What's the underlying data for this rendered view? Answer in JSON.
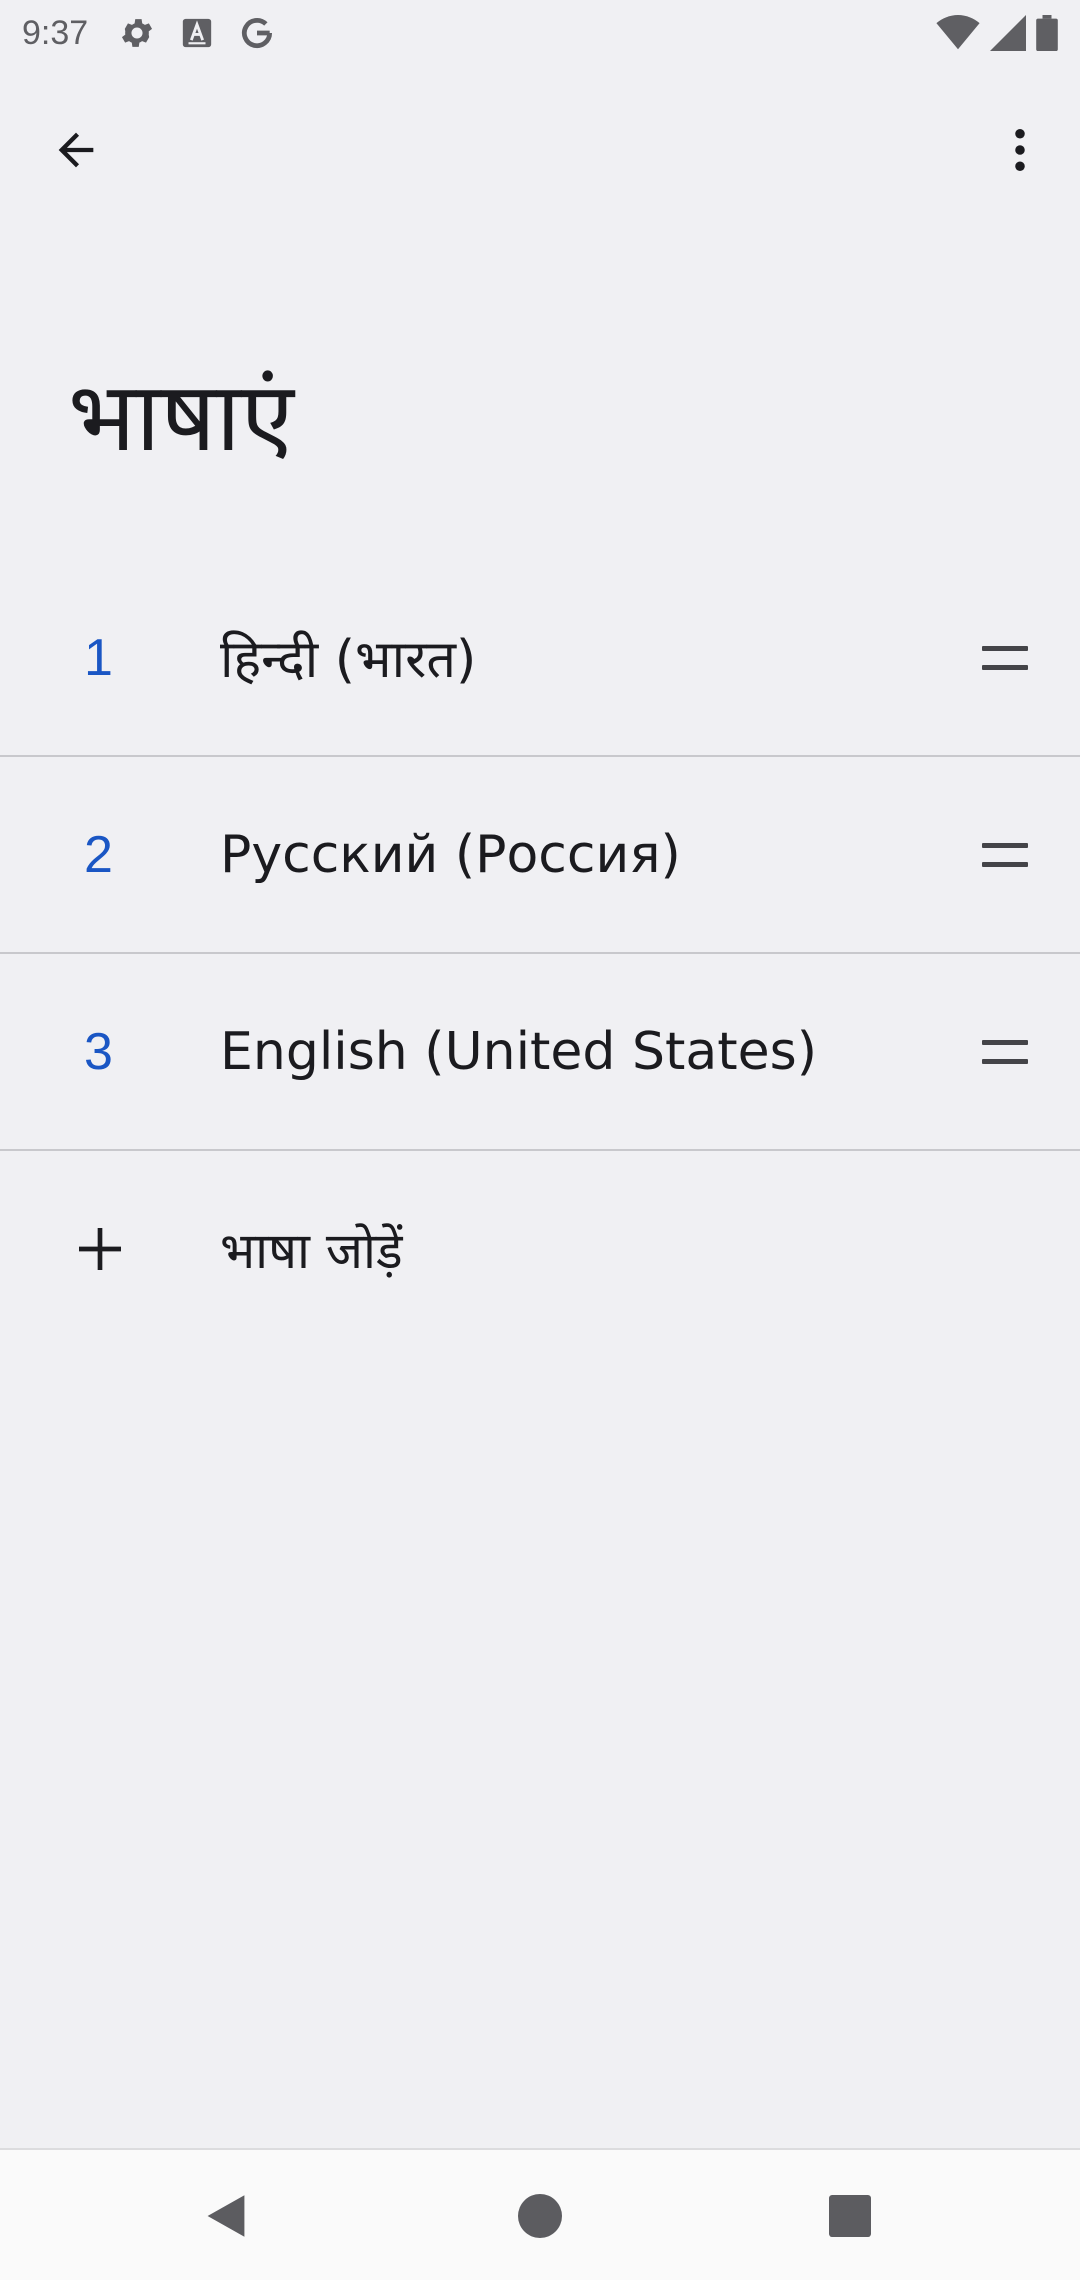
{
  "status_bar": {
    "time": "9:37",
    "left_icons": [
      "settings-icon",
      "font-a-icon",
      "google-g-icon"
    ],
    "right_icons": [
      "wifi-icon",
      "signal-icon",
      "battery-icon"
    ]
  },
  "app_bar": {
    "back_icon": "arrow-back-icon",
    "more_icon": "more-vert-icon"
  },
  "page": {
    "title": "भाषाएं"
  },
  "languages": [
    {
      "index": "1",
      "label": "हिन्दी (भारत)"
    },
    {
      "index": "2",
      "label": "Русский (Россия)"
    },
    {
      "index": "3",
      "label": "English (United States)"
    }
  ],
  "add_language": {
    "label": "भाषा जोड़ें",
    "icon": "plus-icon"
  },
  "nav_bar": {
    "buttons": [
      "nav-back-icon",
      "nav-home-icon",
      "nav-recents-icon"
    ]
  },
  "colors": {
    "accent": "#1a56c4",
    "background": "#f0f0f3",
    "divider": "#c8c8cc"
  }
}
